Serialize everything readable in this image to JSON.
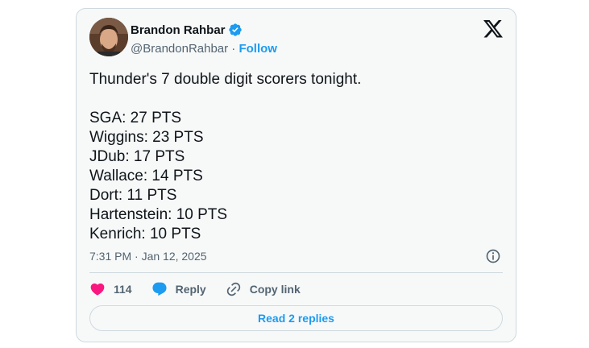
{
  "author": {
    "display_name": "Brandon Rahbar",
    "handle": "@BrandonRahbar",
    "separator": " · ",
    "follow_label": "Follow",
    "verified_icon": "verified-badge-icon",
    "avatar": "profile-photo"
  },
  "tweet": {
    "lines": [
      "Thunder's 7 double digit scorers tonight.",
      "",
      "SGA: 27 PTS",
      "Wiggins: 23 PTS",
      "JDub: 17 PTS",
      "Wallace: 14 PTS",
      "Dort: 11 PTS",
      "Hartenstein: 10 PTS",
      "Kenrich: 10 PTS"
    ],
    "timestamp": "7:31 PM · Jan 12, 2025"
  },
  "actions": {
    "like_count": "114",
    "reply_label": "Reply",
    "copy_link_label": "Copy link"
  },
  "footer": {
    "read_replies_label": "Read 2 replies"
  },
  "colors": {
    "accent": "#1d9bf0",
    "like": "#f91880",
    "text": "#0f1419",
    "muted": "#536471",
    "border": "#cfd9de",
    "card_bg": "#f7f9f9"
  }
}
